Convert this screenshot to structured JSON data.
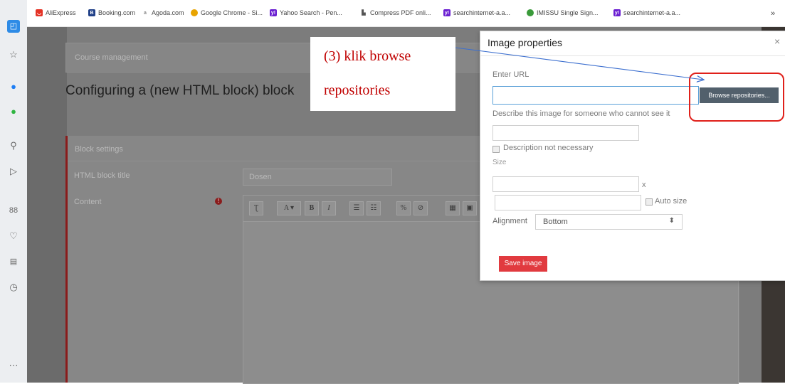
{
  "bookmarks": [
    {
      "label": "AliExpress",
      "icon": "aliexpress-icon",
      "color": "#e43225"
    },
    {
      "label": "Booking.com",
      "icon": "booking-icon",
      "color": "#1f3f87"
    },
    {
      "label": "Agoda.com",
      "icon": "agoda-icon",
      "color": "#888888"
    },
    {
      "label": "Google Chrome - Si...",
      "icon": "chrome-icon",
      "color": "#e8a400"
    },
    {
      "label": "Yahoo Search - Pen...",
      "icon": "yahoo-icon",
      "color": "#6a1fd1"
    },
    {
      "label": "Compress PDF onli...",
      "icon": "pdf-icon",
      "color": "#555555"
    },
    {
      "label": "searchinternet-a.a...",
      "icon": "yahoo-icon",
      "color": "#6a1fd1"
    },
    {
      "label": "IMISSU Single Sign...",
      "icon": "imissu-icon",
      "color": "#3a9a3a"
    },
    {
      "label": "searchinternet-a.a...",
      "icon": "yahoo-icon",
      "color": "#6a1fd1"
    }
  ],
  "bookmarks_more": "»",
  "sidebar_icons": [
    "browser-home-icon",
    "star-icon",
    "messenger-icon",
    "whatsapp-icon",
    "search-icon",
    "send-icon",
    "apps-icon",
    "heart-icon",
    "news-icon",
    "history-icon",
    "more-icon"
  ],
  "page": {
    "breadcrumb": "Course management",
    "heading": "Configuring a (new HTML block) block",
    "settings_header": "Block settings",
    "title_label": "HTML block title",
    "title_value": "Dosen",
    "content_label": "Content",
    "required_mark": "!",
    "toolbar": [
      "Ʈ",
      "A ▾",
      "B",
      "I",
      "☰",
      "☷",
      "%",
      "⊘",
      "▦",
      "▣"
    ]
  },
  "annotation": {
    "line1": "(3) klik browse",
    "line2": "repositories",
    "color": "#c00000"
  },
  "dialog": {
    "title": "Image properties",
    "close": "×",
    "url_label": "Enter URL",
    "url_value": "",
    "browse_button": "Browse repositories...",
    "describe_label": "Describe this image for someone who cannot see it",
    "desc_value": "",
    "no_desc_label": "Description not necessary",
    "size_label": "Size",
    "times": "x",
    "autosize_label": "Auto size",
    "alignment_label": "Alignment",
    "alignment_value": "Bottom",
    "alignment_caret": "⬍",
    "save_button": "Save image",
    "save_color": "#e13a3f"
  }
}
